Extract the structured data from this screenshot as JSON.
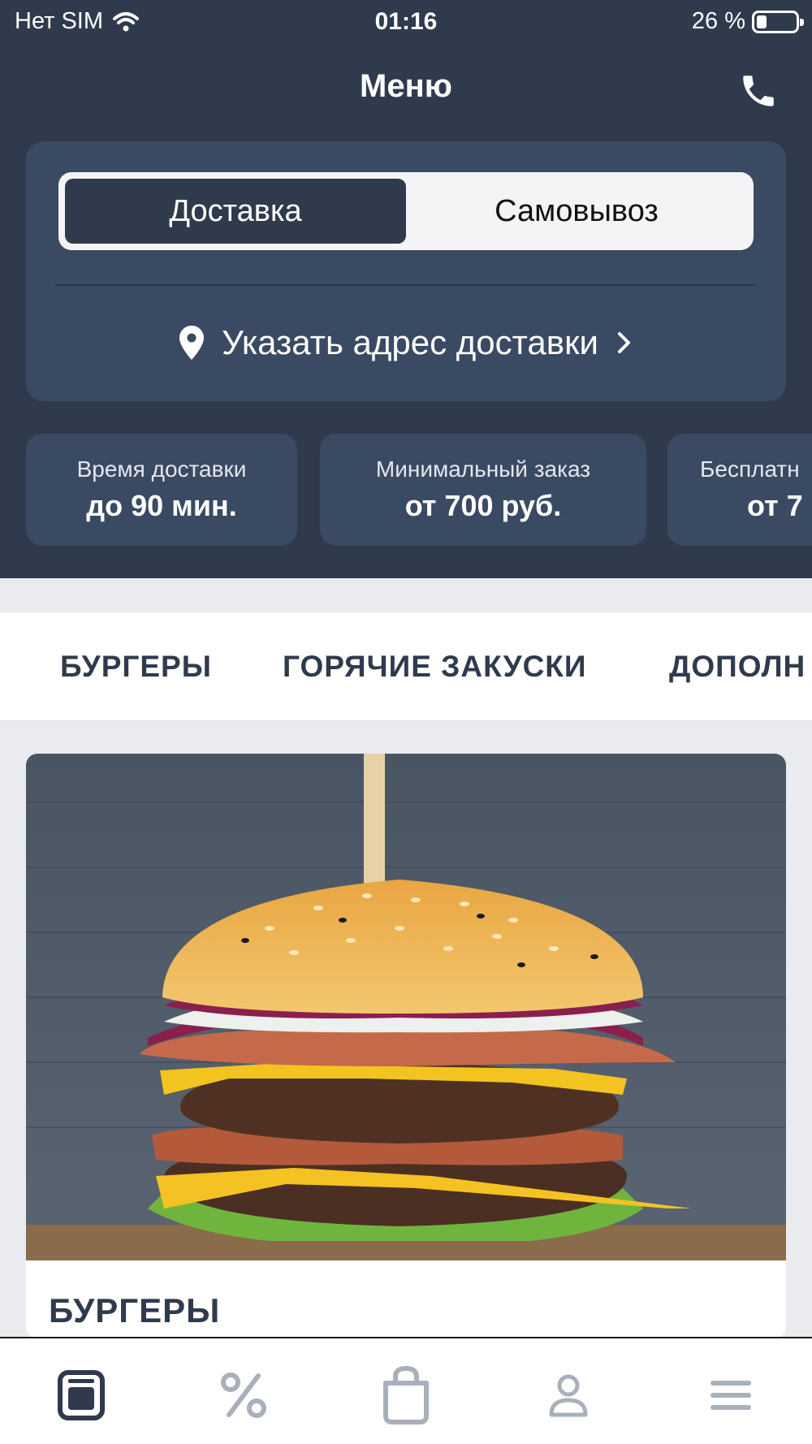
{
  "status_bar": {
    "carrier": "Нет SIM",
    "time": "01:16",
    "battery_percent": "26 %",
    "battery_level": 0.26
  },
  "nav": {
    "title": "Меню",
    "phone_icon": "phone-icon"
  },
  "delivery_mode": {
    "options": [
      "Доставка",
      "Самовывоз"
    ],
    "selected": "Доставка"
  },
  "address": {
    "label": "Указать адрес доставки",
    "pin_icon": "map-pin-icon",
    "chevron_icon": "chevron-right-icon"
  },
  "info_cards": [
    {
      "label": "Время доставки",
      "value": "до 90 мин."
    },
    {
      "label": "Минимальный заказ",
      "value": "от 700 руб."
    },
    {
      "label": "Бесплатн",
      "value": "от 7"
    }
  ],
  "categories": [
    "БУРГЕРЫ",
    "ГОРЯЧИЕ ЗАКУСКИ",
    "ДОПОЛН"
  ],
  "product": {
    "title": "БУРГЕРЫ",
    "image_subject": "burger-photo"
  },
  "tabbar": {
    "items": [
      "menu-icon",
      "discount-icon",
      "cart-icon",
      "profile-icon",
      "more-icon"
    ],
    "active": "menu-icon"
  },
  "colors": {
    "header": "#2f3b4d",
    "card": "#3a4a62",
    "background": "#e9ebef",
    "tab_active": "#2f3b4d",
    "tab_inactive": "#a9b0bc"
  }
}
